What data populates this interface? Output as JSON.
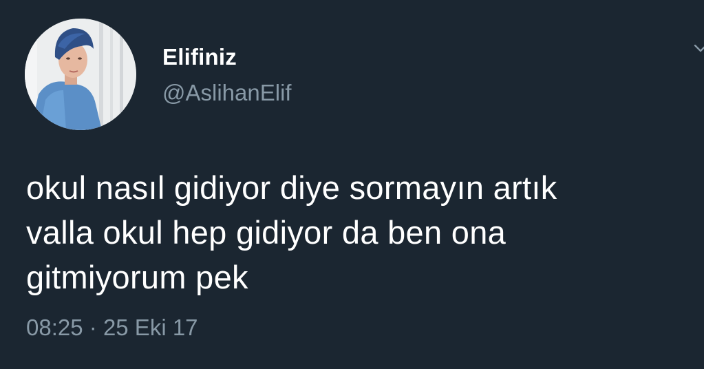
{
  "user": {
    "display_name": "Elifiniz",
    "handle": "@AslihanElif",
    "avatar_icon": "profile-photo"
  },
  "tweet": {
    "text_lines": [
      "okul nasıl gidiyor diye sormayın artık",
      "valla okul hep gidiyor da ben ona",
      "gitmiyorum pek"
    ],
    "time": "08:25",
    "separator": "·",
    "date": "25 Eki 17"
  },
  "icons": {
    "more": "chevron-down-icon"
  },
  "colors": {
    "background": "#1b2631",
    "text_primary": "#ffffff",
    "text_secondary": "#8899a6"
  }
}
